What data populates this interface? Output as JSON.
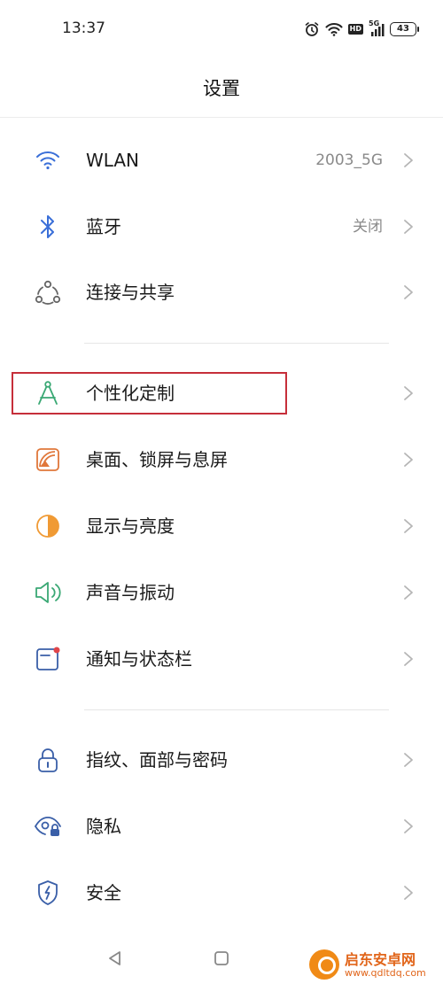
{
  "status_bar": {
    "time": "13:37",
    "battery_level": "43",
    "hd_label": "HD",
    "network_label": "5G",
    "icons": [
      "alarm-icon",
      "wifi-icon",
      "hd-icon",
      "signal-5g-icon",
      "battery-icon"
    ]
  },
  "header": {
    "title": "设置"
  },
  "settings": {
    "items": [
      {
        "label": "WLAN",
        "value": "2003_5G",
        "icon": "wifi-icon",
        "color": "#3a6fd8"
      },
      {
        "label": "蓝牙",
        "value": "关闭",
        "icon": "bluetooth-icon",
        "color": "#3a6fd8"
      },
      {
        "label": "连接与共享",
        "value": "",
        "icon": "share-connections-icon",
        "color": "#666666"
      },
      {
        "label": "个性化定制",
        "value": "",
        "icon": "compass-drafting-icon",
        "color": "#3aa874"
      },
      {
        "label": "桌面、锁屏与息屏",
        "value": "",
        "icon": "wallpaper-icon",
        "color": "#e0773a"
      },
      {
        "label": "显示与亮度",
        "value": "",
        "icon": "brightness-icon",
        "color": "#f09a34"
      },
      {
        "label": "声音与振动",
        "value": "",
        "icon": "speaker-icon",
        "color": "#3aa874"
      },
      {
        "label": "通知与状态栏",
        "value": "",
        "icon": "notification-icon",
        "color": "#3a5fa8"
      },
      {
        "label": "指纹、面部与密码",
        "value": "",
        "icon": "lock-icon",
        "color": "#3a5fa8"
      },
      {
        "label": "隐私",
        "value": "",
        "icon": "privacy-eye-icon",
        "color": "#3a5fa8"
      },
      {
        "label": "安全",
        "value": "",
        "icon": "shield-icon",
        "color": "#3a5fa8"
      }
    ]
  },
  "nav_bar": {
    "buttons": [
      "back-icon",
      "home-icon",
      "recents-icon"
    ]
  },
  "watermark": {
    "title": "启东安卓网",
    "url": "www.qdltdq.com"
  },
  "highlight_color": "#c62f3a"
}
